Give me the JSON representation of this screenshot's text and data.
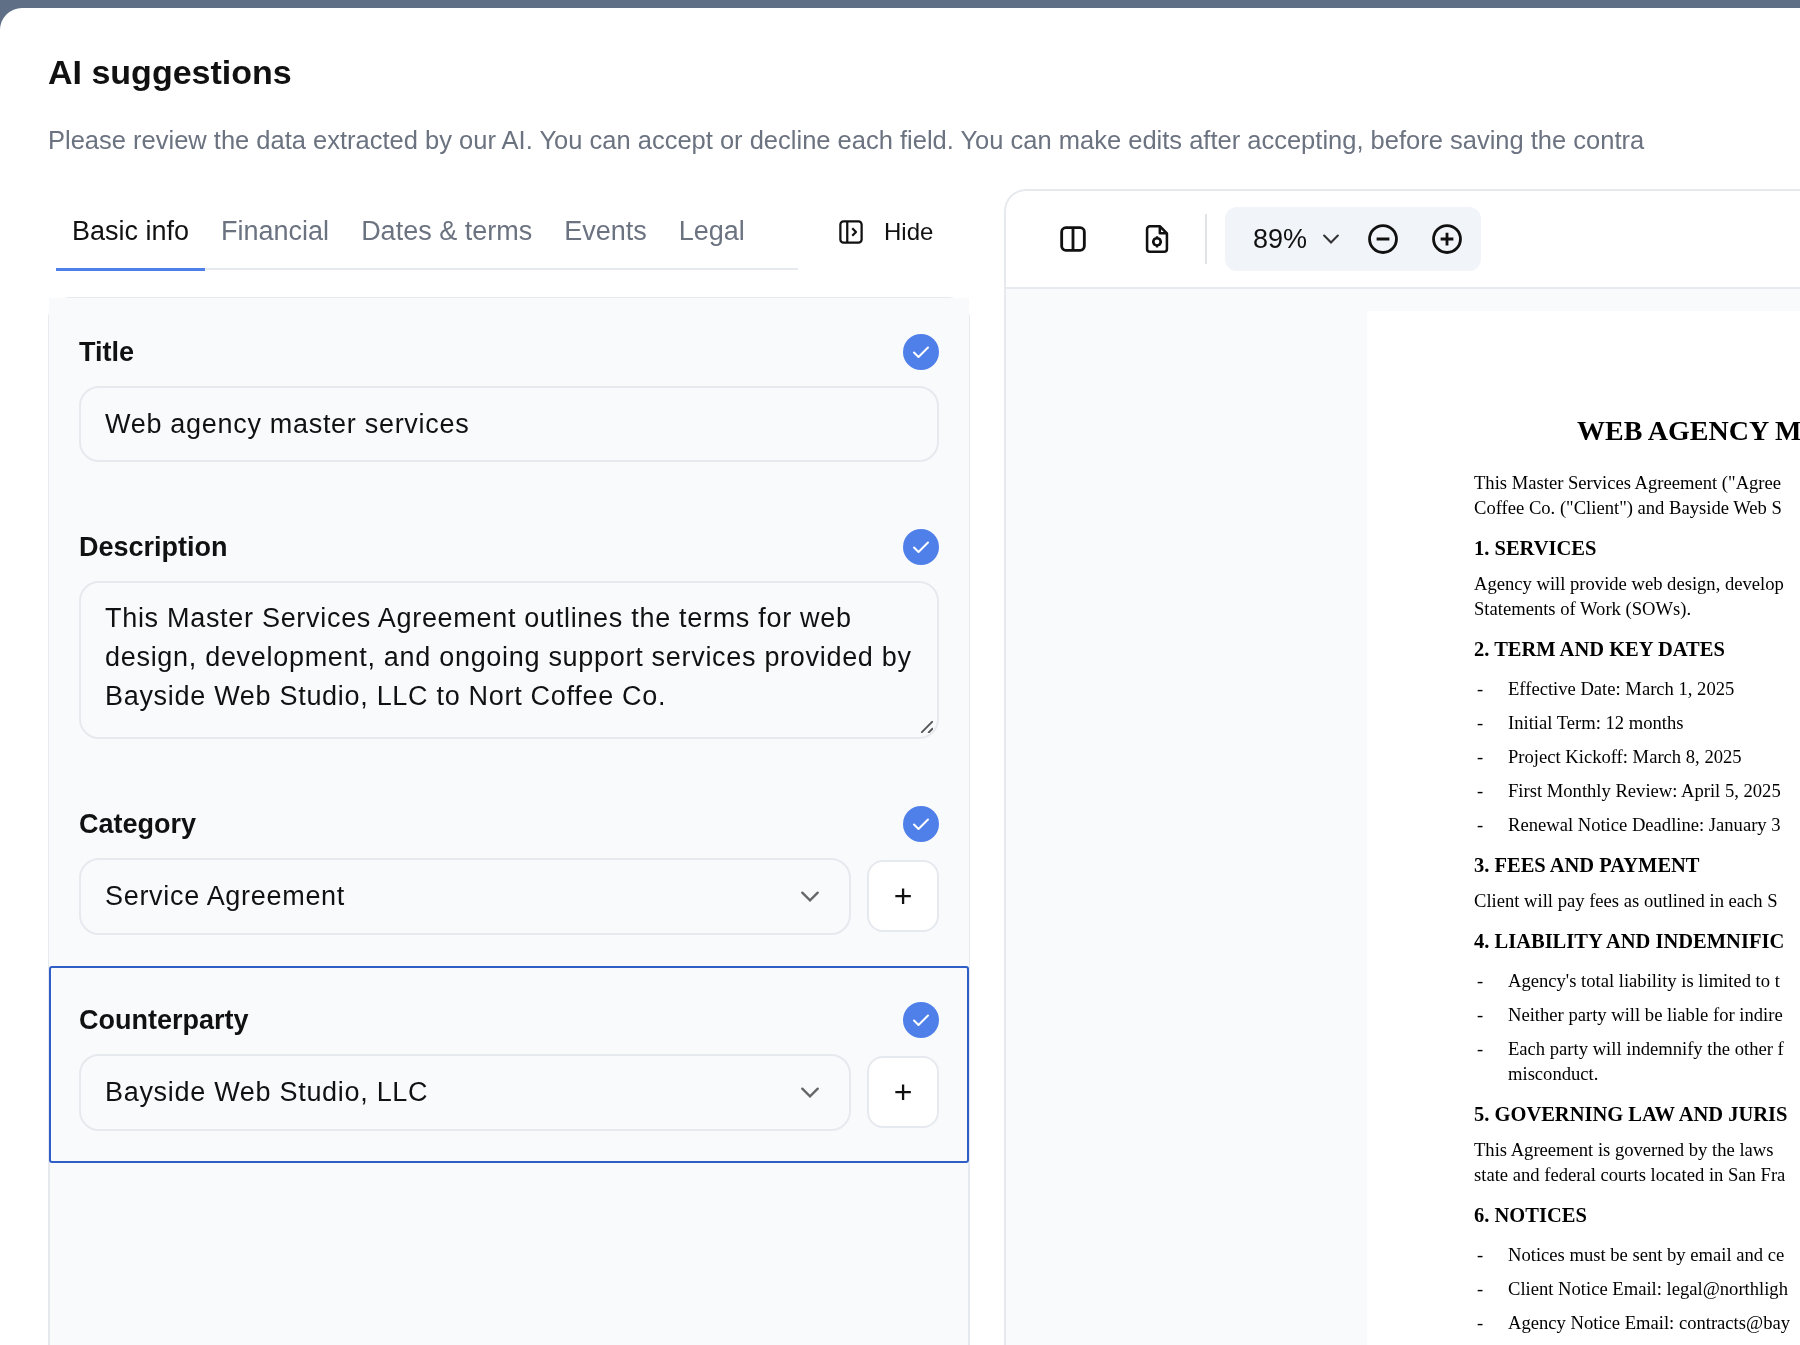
{
  "dialog": {
    "title": "AI suggestions",
    "subtitle": "Please review the data extracted by our AI. You can accept or decline each field. You can make edits after accepting, before saving the contra"
  },
  "tabs": [
    {
      "label": "Basic info",
      "selected": true
    },
    {
      "label": "Financial",
      "selected": false
    },
    {
      "label": "Dates & terms",
      "selected": false
    },
    {
      "label": "Events",
      "selected": false
    },
    {
      "label": "Legal",
      "selected": false
    }
  ],
  "hide_button": {
    "label": "Hide"
  },
  "fields": [
    {
      "label": "Title",
      "kind": "text",
      "value": "Web agency master services",
      "accepted": true,
      "selected": false
    },
    {
      "label": "Description",
      "kind": "textarea",
      "value": "This Master Services Agreement outlines the terms for web design, development, and ongoing support services provided by Bayside Web Studio, LLC to Nort Coffee Co.",
      "accepted": true,
      "selected": false
    },
    {
      "label": "Category",
      "kind": "select",
      "value": "Service Agreement",
      "add_button": "+",
      "accepted": true,
      "selected": false
    },
    {
      "label": "Counterparty",
      "kind": "select",
      "value": "Bayside Web Studio, LLC",
      "add_button": "+",
      "accepted": true,
      "selected": true
    }
  ],
  "viewer": {
    "zoom": "89%",
    "document": {
      "title": "WEB AGENCY M",
      "blocks": [
        {
          "kind": "paragraph",
          "lines": [
            "This Master Services Agreement (\"Agree",
            "Coffee Co. (\"Client\") and Bayside Web S"
          ]
        },
        {
          "kind": "heading",
          "text": "1. SERVICES"
        },
        {
          "kind": "paragraph",
          "lines": [
            "Agency will provide web design, develop",
            "Statements of Work (SOWs)."
          ]
        },
        {
          "kind": "heading",
          "text": "2. TERM AND KEY DATES"
        },
        {
          "kind": "list",
          "marker": "-",
          "items": [
            {
              "lines": [
                "Effective Date: March 1, 2025"
              ]
            },
            {
              "lines": [
                "Initial Term: 12 months"
              ]
            },
            {
              "lines": [
                "Project Kickoff: March 8, 2025"
              ]
            },
            {
              "lines": [
                "First Monthly Review: April 5, 2025"
              ]
            },
            {
              "lines": [
                "Renewal Notice Deadline: January 3"
              ]
            }
          ]
        },
        {
          "kind": "heading",
          "text": "3. FEES AND PAYMENT"
        },
        {
          "kind": "paragraph",
          "lines": [
            "Client will pay fees as outlined in each S"
          ]
        },
        {
          "kind": "heading",
          "text": "4. LIABILITY AND INDEMNIFIC"
        },
        {
          "kind": "list",
          "marker": "-",
          "items": [
            {
              "lines": [
                "Agency's total liability is limited to t"
              ]
            },
            {
              "lines": [
                "Neither party will be liable for indire"
              ]
            },
            {
              "lines": [
                "Each party will indemnify the other f",
                "misconduct."
              ]
            }
          ]
        },
        {
          "kind": "heading",
          "text": "5. GOVERNING LAW AND JURIS"
        },
        {
          "kind": "paragraph",
          "lines": [
            "This Agreement is governed by the laws",
            "state and federal courts located in San Fra"
          ]
        },
        {
          "kind": "heading",
          "text": "6. NOTICES"
        },
        {
          "kind": "list",
          "marker": "-",
          "items": [
            {
              "lines": [
                "Notices must be sent by email and ce"
              ]
            },
            {
              "lines": [
                "Client Notice Email: legal@northligh"
              ]
            },
            {
              "lines": [
                "Agency Notice Email: contracts@bay"
              ]
            }
          ]
        }
      ]
    }
  }
}
